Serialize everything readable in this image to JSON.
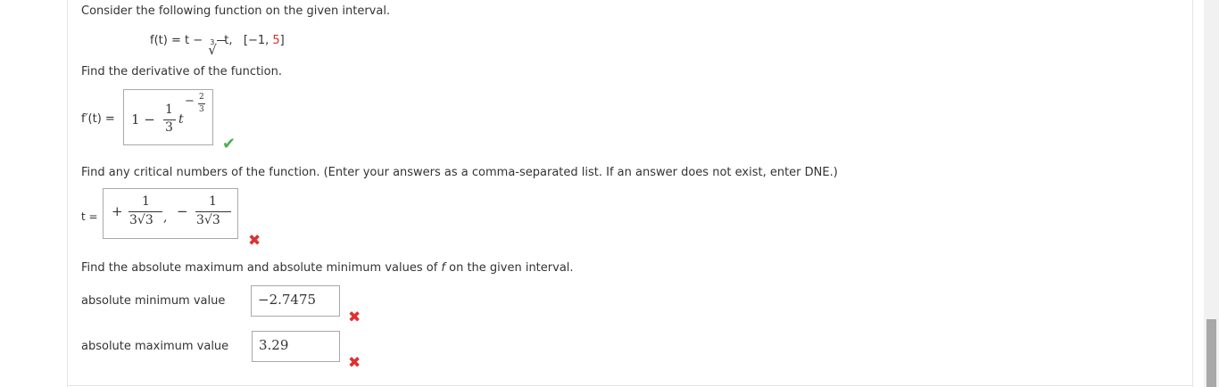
{
  "intro": "Consider the following function on the given interval.",
  "function": {
    "lhs": "f(t) = t − ",
    "root_index": "3",
    "radical": "√",
    "radicand": "t,",
    "interval_open": "[−1, ",
    "interval_end": "5",
    "interval_close": "]"
  },
  "derivative": {
    "prompt": "Find the derivative of the function.",
    "label": "f′(t) =",
    "one": "1 −",
    "num": "1",
    "den": "3",
    "var": "t",
    "exp_sign": "−",
    "exp_num": "2",
    "exp_den": "3",
    "status": "correct"
  },
  "critical": {
    "prompt": "Find any critical numbers of the function. (Enter your answers as a comma-separated list. If an answer does not exist, enter DNE.)",
    "label": "t =",
    "plus": "+",
    "num1": "1",
    "den1": "3√3",
    "comma": ",",
    "minus": "−",
    "num2": "1",
    "den2": "3√3",
    "status": "incorrect"
  },
  "extrema": {
    "prompt_before": "Find the absolute maximum and absolute minimum values of ",
    "prompt_f": "f",
    "prompt_after": " on the given interval.",
    "min_label": "absolute minimum value",
    "min_value": "−2.7475",
    "min_status": "incorrect",
    "max_label": "absolute maximum value",
    "max_value": "3.29",
    "max_status": "incorrect"
  },
  "icons": {
    "check": "✔",
    "cross": "✖"
  },
  "colors": {
    "correct": "#4caf50",
    "incorrect": "#e03030",
    "interval_end": "#d03030"
  }
}
